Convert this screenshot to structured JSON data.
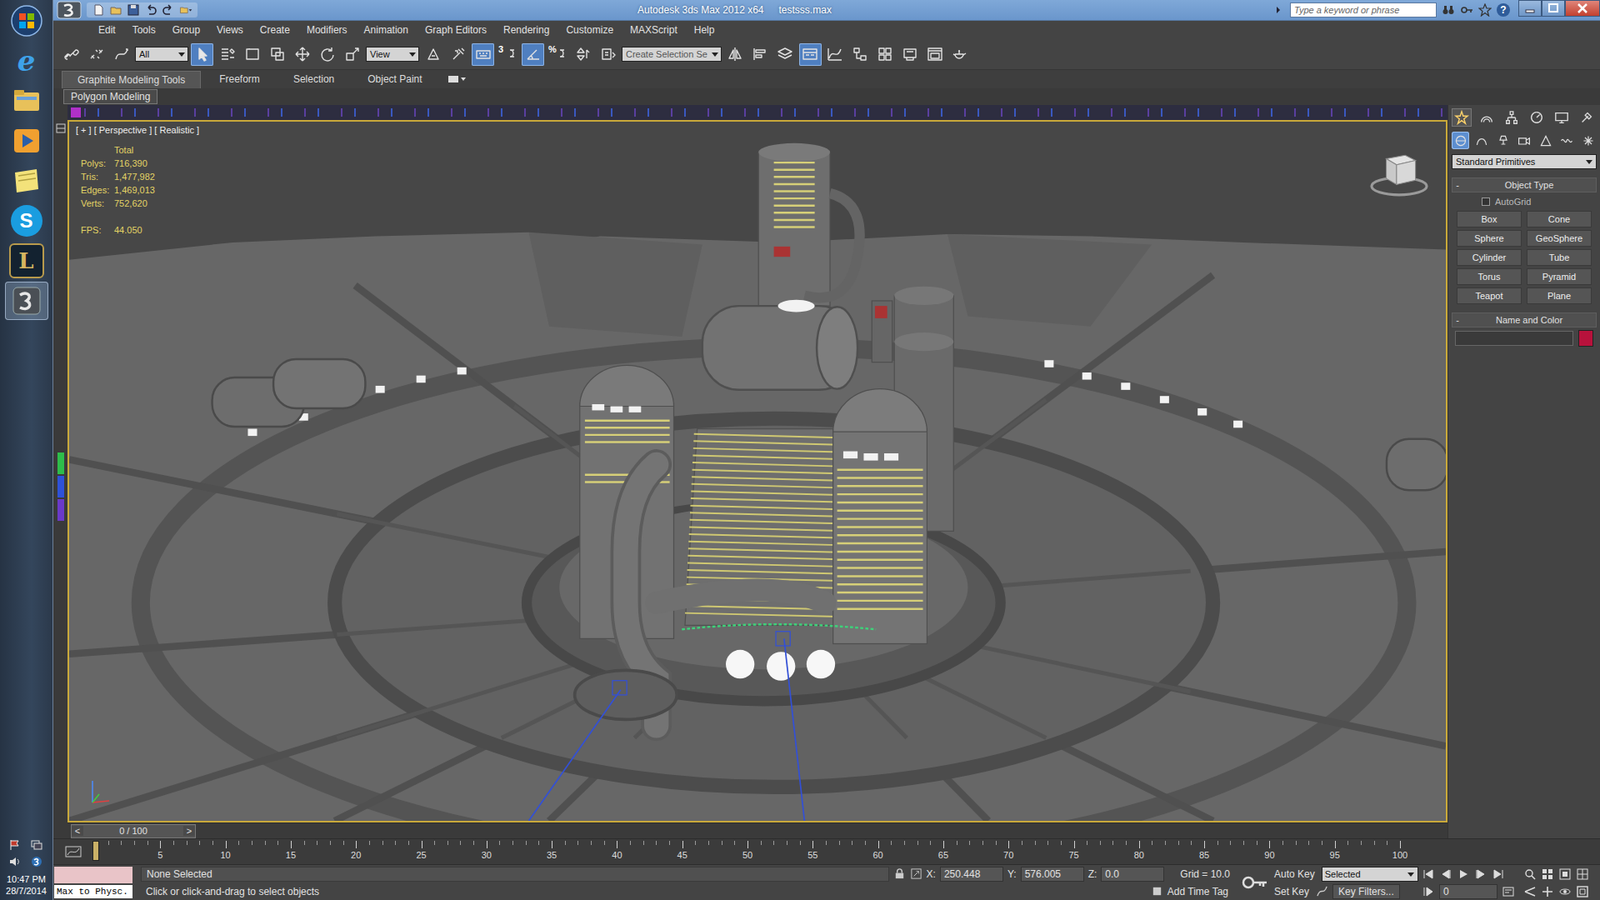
{
  "window": {
    "title": "Autodesk 3ds Max 2012 x64",
    "file": "testsss.max",
    "search_placeholder": "Type a keyword or phrase",
    "help_glyph": "?"
  },
  "menu": [
    "Edit",
    "Tools",
    "Group",
    "Views",
    "Create",
    "Modifiers",
    "Animation",
    "Graph Editors",
    "Rendering",
    "Customize",
    "MAXScript",
    "Help"
  ],
  "toolbar": {
    "items": [
      {
        "kind": "link",
        "selected": false
      },
      {
        "kind": "unlink",
        "selected": false
      },
      {
        "kind": "bind",
        "selected": false
      },
      {
        "kind": "dropdown",
        "value": "All",
        "selected": false
      },
      {
        "kind": "select",
        "selected": true
      },
      {
        "kind": "select-by-name",
        "selected": false
      },
      {
        "kind": "region",
        "selected": false
      },
      {
        "kind": "crossing",
        "selected": false
      },
      {
        "kind": "move",
        "selected": false
      },
      {
        "kind": "rotate",
        "selected": false
      },
      {
        "kind": "scale",
        "selected": false
      },
      {
        "kind": "dropdown",
        "value": "View",
        "selected": false
      },
      {
        "kind": "pivot",
        "selected": false
      },
      {
        "kind": "manipulate",
        "selected": false
      },
      {
        "kind": "keyboard",
        "selected": true
      },
      {
        "kind": "snap",
        "glyph": "3",
        "selected": false
      },
      {
        "kind": "angle-snap",
        "selected": true
      },
      {
        "kind": "percent-snap",
        "glyph": "%",
        "selected": false
      },
      {
        "kind": "spinner-snap",
        "selected": false
      },
      {
        "kind": "named-selection",
        "selected": false
      },
      {
        "kind": "dropdown",
        "value": "Create Selection Se",
        "selected": false
      },
      {
        "kind": "mirror",
        "selected": false
      },
      {
        "kind": "align",
        "selected": false
      },
      {
        "kind": "layers",
        "selected": false
      },
      {
        "kind": "ribbon",
        "selected": true
      },
      {
        "kind": "curve-editor",
        "selected": false
      },
      {
        "kind": "schematic",
        "selected": false
      },
      {
        "kind": "material-editor",
        "selected": false
      },
      {
        "kind": "render-setup",
        "selected": false
      },
      {
        "kind": "frame-window",
        "selected": false
      },
      {
        "kind": "render",
        "selected": false
      }
    ]
  },
  "ribbon": {
    "tabs": [
      {
        "label": "Graphite Modeling Tools",
        "selected": true
      },
      {
        "label": "Freeform",
        "selected": false
      },
      {
        "label": "Selection",
        "selected": false
      },
      {
        "label": "Object Paint",
        "selected": false
      }
    ],
    "panel": "Polygon Modeling"
  },
  "viewport": {
    "labels": [
      "[ + ]",
      "[ Perspective ]",
      "[ Realistic ]"
    ],
    "active": true,
    "stats": {
      "title": "Total",
      "rows": [
        {
          "label": "Polys:",
          "value": "716,390"
        },
        {
          "label": "Tris:",
          "value": "1,477,982"
        },
        {
          "label": "Edges:",
          "value": "1,469,013"
        },
        {
          "label": "Verts:",
          "value": "752,620"
        }
      ],
      "fps": {
        "label": "FPS:",
        "value": "44.050"
      }
    }
  },
  "command_panel": {
    "tabs": [
      {
        "kind": "create",
        "selected": true
      },
      {
        "kind": "modify",
        "selected": false
      },
      {
        "kind": "hierarchy",
        "selected": false
      },
      {
        "kind": "motion",
        "selected": false
      },
      {
        "kind": "display",
        "selected": false
      },
      {
        "kind": "utilities",
        "selected": false
      }
    ],
    "categories": [
      {
        "kind": "geometry",
        "selected": true
      },
      {
        "kind": "shapes",
        "selected": false
      },
      {
        "kind": "lights",
        "selected": false
      },
      {
        "kind": "cameras",
        "selected": false
      },
      {
        "kind": "helpers",
        "selected": false
      },
      {
        "kind": "space-warps",
        "selected": false
      },
      {
        "kind": "systems",
        "selected": false
      }
    ],
    "dropdown": "Standard Primitives",
    "object_type": {
      "sign": "-",
      "title": "Object Type",
      "autogrid": {
        "label": "AutoGrid",
        "checked": false
      },
      "buttons": [
        "Box",
        "Cone",
        "Sphere",
        "GeoSphere",
        "Cylinder",
        "Tube",
        "Torus",
        "Pyramid",
        "Teapot",
        "Plane"
      ]
    },
    "name_and_color": {
      "sign": "-",
      "title": "Name and Color",
      "name": "",
      "color": "#b8123c"
    }
  },
  "time_slider": {
    "prev": "<",
    "label": "0 / 100",
    "next": ">"
  },
  "trackbar": {
    "ticks": [
      "0",
      "5",
      "10",
      "15",
      "20",
      "25",
      "30",
      "35",
      "40",
      "45",
      "50",
      "55",
      "60",
      "65",
      "70",
      "75",
      "80",
      "85",
      "90",
      "95",
      "100"
    ]
  },
  "status_bar": {
    "maxscript": "Max to Physc.",
    "selection": "None Selected",
    "prompt": "Click or click-and-drag to select objects",
    "coords": [
      {
        "axis": "X:",
        "value": "250.448"
      },
      {
        "axis": "Y:",
        "value": "576.005"
      },
      {
        "axis": "Z:",
        "value": "0.0"
      }
    ],
    "grid": "Grid = 10.0",
    "add_time_tag": "Add Time Tag",
    "auto_key": {
      "label": "Auto Key",
      "on": false
    },
    "key_mode": "Selected",
    "set_key": "Set Key",
    "key_filters": "Key Filters...",
    "frame": "0"
  },
  "taskbar": {
    "apps": [
      {
        "kind": "start",
        "selected": false
      },
      {
        "kind": "ie",
        "glyph": "e",
        "selected": false
      },
      {
        "kind": "explorer",
        "selected": false
      },
      {
        "kind": "media",
        "selected": false
      },
      {
        "kind": "notes",
        "selected": false
      },
      {
        "kind": "skype",
        "glyph": "S",
        "selected": false
      },
      {
        "kind": "league",
        "glyph": "L",
        "selected": false
      },
      {
        "kind": "max",
        "selected": true
      }
    ],
    "time": "10:47 PM",
    "date": "28/7/2014"
  }
}
